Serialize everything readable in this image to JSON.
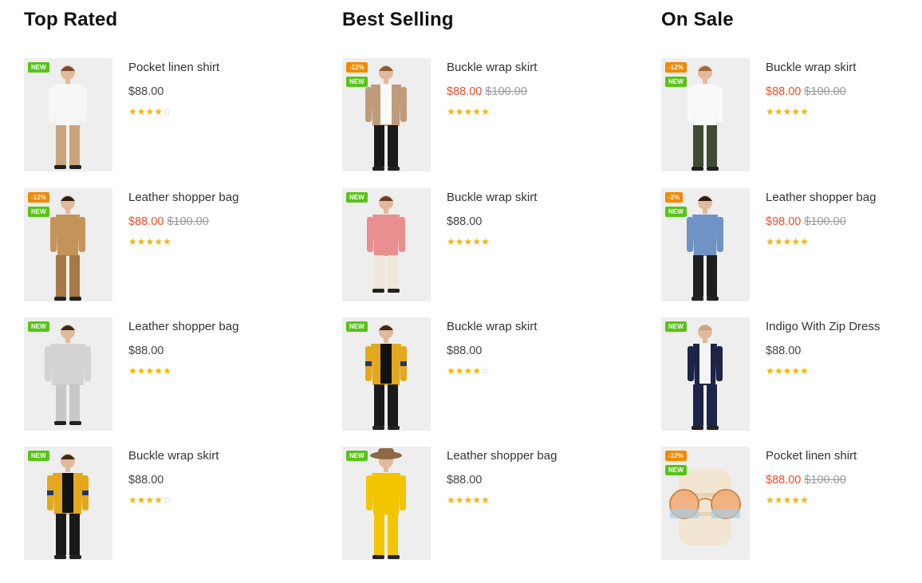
{
  "sections": [
    {
      "title": "Top Rated",
      "products": [
        {
          "name": "Pocket linen shirt",
          "price": "$88.00",
          "old_price": "",
          "sale_badge": "",
          "new_badge": "NEW",
          "rating": 4,
          "image": "woman-white-top"
        },
        {
          "name": "Leather shopper bag",
          "price": "$88.00",
          "old_price": "$100.00",
          "sale_badge": "-12%",
          "new_badge": "NEW",
          "rating": 5,
          "image": "man-khaki-outfit"
        },
        {
          "name": "Leather shopper bag",
          "price": "$88.00",
          "old_price": "",
          "sale_badge": "",
          "new_badge": "NEW",
          "rating": 5,
          "image": "man-grey-coat"
        },
        {
          "name": "Buckle wrap skirt",
          "price": "$88.00",
          "old_price": "",
          "sale_badge": "",
          "new_badge": "NEW",
          "rating": 4,
          "image": "man-yellow-cardigan"
        }
      ]
    },
    {
      "title": "Best Selling",
      "products": [
        {
          "name": "Buckle wrap skirt",
          "price": "$88.00",
          "old_price": "$100.00",
          "sale_badge": "-12%",
          "new_badge": "NEW",
          "rating": 5,
          "image": "woman-trench-coat"
        },
        {
          "name": "Buckle wrap skirt",
          "price": "$88.00",
          "old_price": "",
          "sale_badge": "",
          "new_badge": "NEW",
          "rating": 5,
          "image": "woman-pink-blouse"
        },
        {
          "name": "Buckle wrap skirt",
          "price": "$88.00",
          "old_price": "",
          "sale_badge": "",
          "new_badge": "NEW",
          "rating": 4,
          "image": "man-yellow-cardigan"
        },
        {
          "name": "Leather shopper bag",
          "price": "$88.00",
          "old_price": "",
          "sale_badge": "",
          "new_badge": "NEW",
          "rating": 5,
          "image": "woman-yellow-suit"
        }
      ]
    },
    {
      "title": "On Sale",
      "products": [
        {
          "name": "Buckle wrap skirt",
          "price": "$88.00",
          "old_price": "$100.00",
          "sale_badge": "-12%",
          "new_badge": "NEW",
          "rating": 5,
          "image": "woman-green-trousers"
        },
        {
          "name": "Leather shopper bag",
          "price": "$98.00",
          "old_price": "$100.00",
          "sale_badge": "-2%",
          "new_badge": "NEW",
          "rating": 5,
          "image": "man-denim-shirt"
        },
        {
          "name": "Indigo With Zip Dress",
          "price": "$88.00",
          "old_price": "",
          "sale_badge": "",
          "new_badge": "NEW",
          "rating": 5,
          "image": "woman-navy-blazer"
        },
        {
          "name": "Pocket linen shirt",
          "price": "$88.00",
          "old_price": "$100.00",
          "sale_badge": "-12%",
          "new_badge": "NEW",
          "rating": 5,
          "image": "sunglasses-bag"
        }
      ]
    }
  ],
  "rating_max": 5,
  "colors": {
    "sale_price": "#ee4b2b",
    "sale_badge": "#f08a00",
    "new_badge": "#58c317",
    "star": "#f6b400",
    "star_empty": "#bdbdbd",
    "thumb_bg": "#eeeeee"
  }
}
